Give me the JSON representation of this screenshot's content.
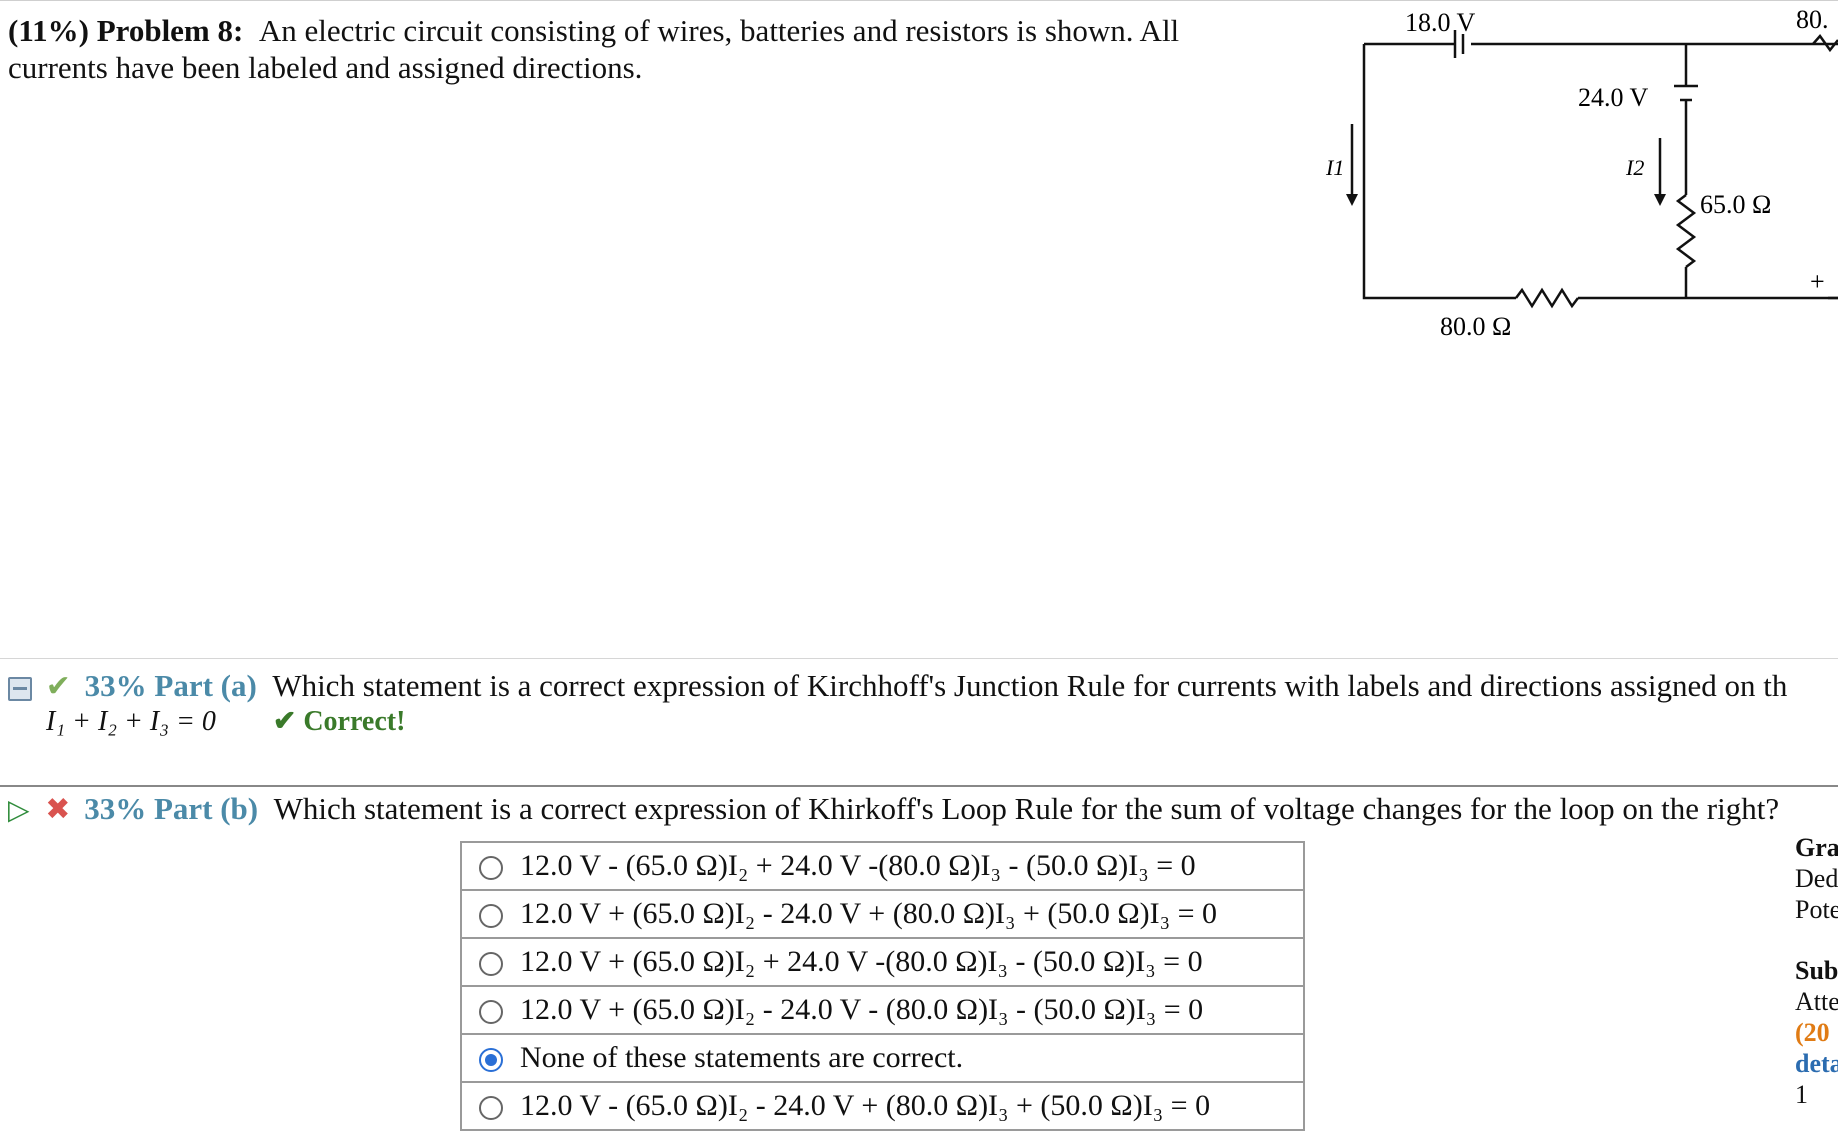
{
  "problem": {
    "percent": "(11%)",
    "title": "Problem 8:",
    "text": "An electric circuit consisting of wires, batteries and resistors is shown. All currents have been labeled and assigned directions."
  },
  "circuit": {
    "labels": {
      "v18": "18.0 V",
      "v80_partial": "80.",
      "v24": "24.0 V",
      "i1": "I1",
      "i2": "I2",
      "r65": "65.0 Ω",
      "r80": "80.0 Ω",
      "plus": "+"
    }
  },
  "part_a": {
    "percent": "33%",
    "label": "Part (a)",
    "question": "Which statement is a correct expression of Kirchhoff's Junction Rule for currents with labels and directions assigned on th",
    "answer": "I₁ + I₂ + I₃ = 0",
    "status": "✔ Correct!"
  },
  "part_b": {
    "percent": "33%",
    "label": "Part (b)",
    "question": "Which statement is a correct expression of Khirkoff's Loop Rule for the sum of voltage changes for the loop on the right?",
    "options": [
      {
        "text": "12.0 V - (65.0 Ω)I₂ + 24.0 V -(80.0 Ω)I₃ - (50.0 Ω)I₃ = 0",
        "selected": false
      },
      {
        "text": "12.0 V + (65.0 Ω)I₂ - 24.0 V + (80.0 Ω)I₃ + (50.0 Ω)I₃ = 0",
        "selected": false
      },
      {
        "text": "12.0 V + (65.0 Ω)I₂ + 24.0 V -(80.0 Ω)I₃ - (50.0 Ω)I₃ = 0",
        "selected": false
      },
      {
        "text": "12.0 V + (65.0 Ω)I₂ - 24.0 V - (80.0 Ω)I₃ - (50.0 Ω)I₃ = 0",
        "selected": false
      },
      {
        "text": "None of these statements are correct.",
        "selected": true
      },
      {
        "text": "12.0 V - (65.0 Ω)I₂ - 24.0 V + (80.0 Ω)I₃ + (50.0 Ω)I₃ = 0",
        "selected": false
      }
    ]
  },
  "side_panel": {
    "gra": "Gra",
    "ded": "Ded",
    "pote": "Pote",
    "sub": "Sub",
    "atte": "Atte",
    "pct": "(20",
    "deta": "deta",
    "count": "1"
  },
  "colors": {
    "accent": "#4b8aa8",
    "correct": "#3a7a2a",
    "wrong": "#d9534f",
    "radio_selected": "#2a6fd6"
  }
}
